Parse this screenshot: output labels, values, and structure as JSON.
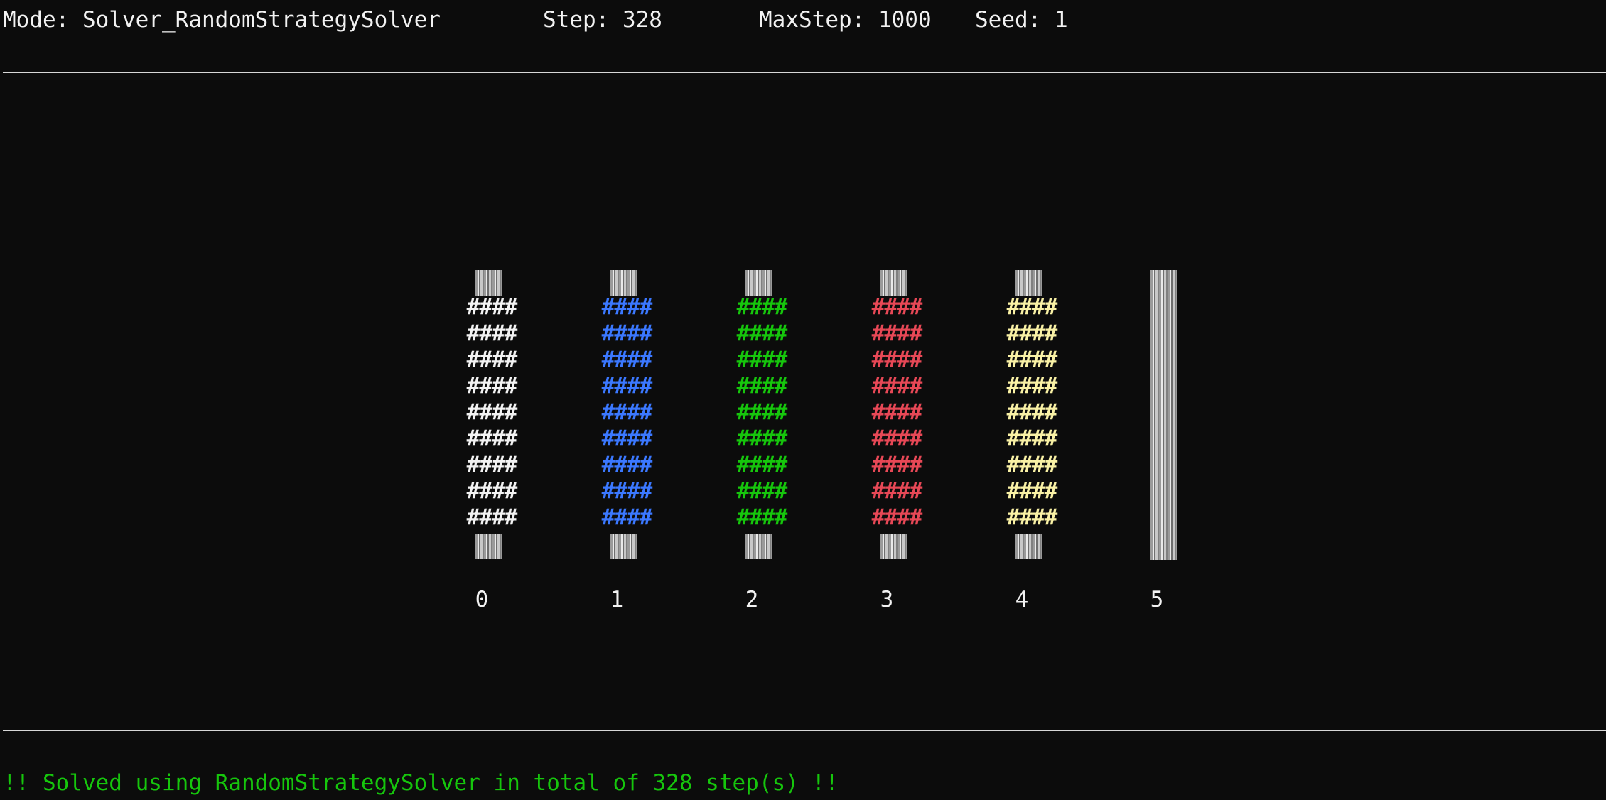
{
  "header": {
    "mode": "Mode: Solver_RandomStrategySolver",
    "step": "Step: 328",
    "max_step": "MaxStep: 1000",
    "seed": "Seed: 1"
  },
  "board": {
    "towers": [
      {
        "label": "0",
        "color": "#f2f2f2",
        "discs": [
          "####",
          "####",
          "####",
          "####",
          "####",
          "####",
          "####",
          "####",
          "####"
        ]
      },
      {
        "label": "1",
        "color": "#3b78ff",
        "discs": [
          "####",
          "####",
          "####",
          "####",
          "####",
          "####",
          "####",
          "####",
          "####"
        ]
      },
      {
        "label": "2",
        "color": "#16c60c",
        "discs": [
          "####",
          "####",
          "####",
          "####",
          "####",
          "####",
          "####",
          "####",
          "####"
        ]
      },
      {
        "label": "3",
        "color": "#e74856",
        "discs": [
          "####",
          "####",
          "####",
          "####",
          "####",
          "####",
          "####",
          "####",
          "####"
        ]
      },
      {
        "label": "4",
        "color": "#f9f1a5",
        "discs": [
          "####",
          "####",
          "####",
          "####",
          "####",
          "####",
          "####",
          "####",
          "####"
        ]
      },
      {
        "label": "5",
        "color": "#cccccc",
        "discs": []
      }
    ]
  },
  "status": {
    "message": "!! Solved using RandomStrategySolver in total of 328 step(s) !!",
    "color": "#16c60c"
  }
}
